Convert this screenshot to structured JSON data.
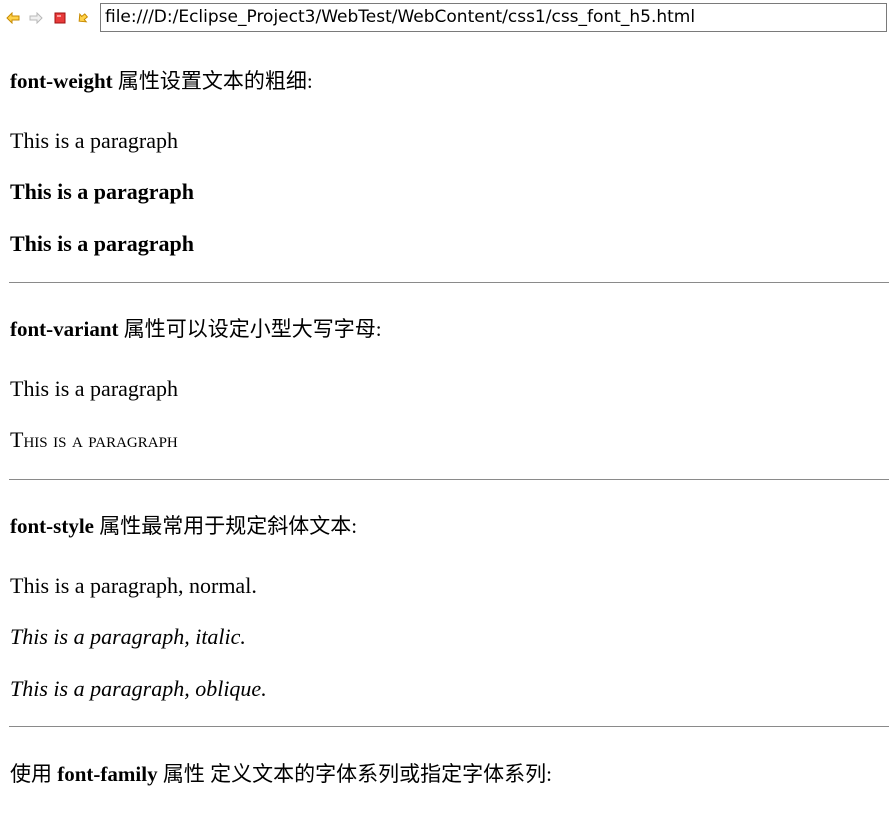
{
  "browser": {
    "url": "file:///D:/Eclipse_Project3/WebTest/WebContent/css1/css_font_h5.html",
    "toolbar_icons": [
      "back-icon",
      "forward-icon",
      "stop-icon",
      "refresh-icon"
    ],
    "icon_colors": {
      "back": "#e8a000",
      "forward": "#c8c8c8",
      "stop": "#e02020",
      "refresh": "#e8a000"
    }
  },
  "sections": [
    {
      "heading_prop": "font-weight",
      "heading_text": " 属性设置文本的粗细:",
      "paragraphs": [
        "This is a paragraph",
        "This is a paragraph",
        "This is a paragraph"
      ]
    },
    {
      "heading_prop": "font-variant",
      "heading_text": " 属性可以设定小型大写字母:",
      "paragraphs": [
        "This is a paragraph",
        "This is a paragraph"
      ]
    },
    {
      "heading_prop": "font-style",
      "heading_text": " 属性最常用于规定斜体文本:",
      "paragraphs": [
        "This is a paragraph, normal.",
        "This is a paragraph, italic.",
        "This is a paragraph, oblique."
      ]
    },
    {
      "heading_prefix": "使用 ",
      "heading_prop": "font-family",
      "heading_text": " 属性 定义文本的字体系列或指定字体系列:"
    }
  ]
}
